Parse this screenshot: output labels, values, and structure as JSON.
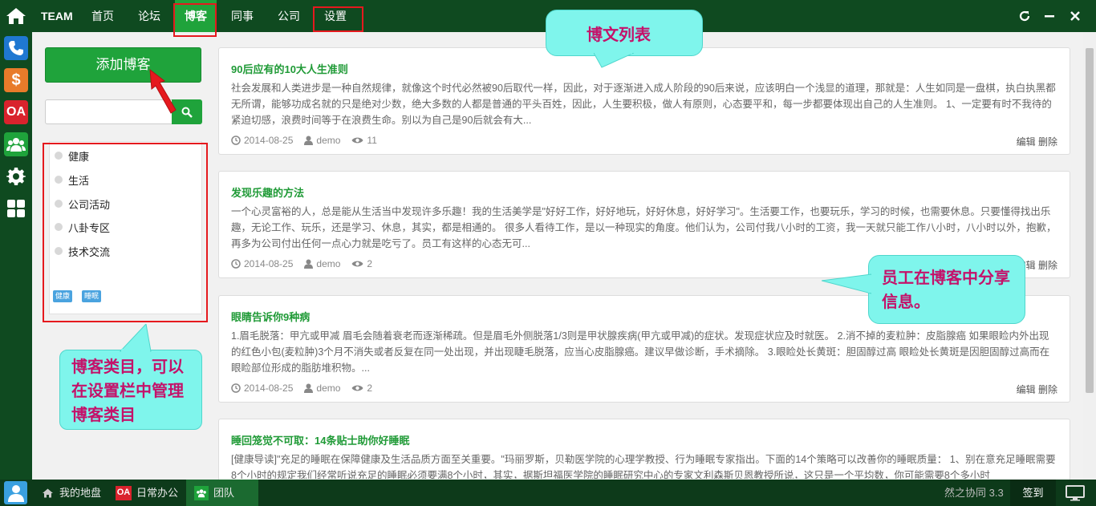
{
  "topnav": {
    "brand": "TEAM",
    "items": [
      "首页",
      "论坛",
      "博客",
      "同事",
      "公司",
      "设置"
    ],
    "active_index": 2
  },
  "window_controls": [
    "refresh-icon",
    "minimize-icon",
    "close-icon"
  ],
  "dock": {
    "items": [
      "home-icon",
      "phone-icon",
      "dollar-icon",
      "OA",
      "users-icon",
      "gear-icon",
      "grid-icon"
    ]
  },
  "sidebar": {
    "add_button": "添加博客",
    "search_placeholder": "",
    "categories": [
      "健康",
      "生活",
      "公司活动",
      "八卦专区",
      "技术交流"
    ],
    "tags": [
      "健康",
      "睡眠"
    ]
  },
  "posts": [
    {
      "title": "90后应有的10大人生准则",
      "excerpt": "社会发展和人类进步是一种自然规律，就像这个时代必然被90后取代一样，因此，对于逐渐进入成人阶段的90后来说，应该明白一个浅显的道理，那就是：人生如同是一盘棋，执白执黑都无所谓，能够功成名就的只是绝对少数，绝大多数的人都是普通的平头百姓，因此，人生要积极，做人有原则，心态要平和，每一步都要体现出自己的人生准则。 1、一定要有时不我待的紧迫切感，浪费时间等于在浪费生命。别以为自己是90后就会有大...",
      "date": "2014-08-25",
      "author": "demo",
      "views": "11",
      "edit": "编辑",
      "delete": "删除"
    },
    {
      "title": "发现乐趣的方法",
      "excerpt": "一个心灵富裕的人，总是能从生活当中发现许多乐趣！我的生活美学是\"好好工作，好好地玩，好好休息，好好学习\"。生活要工作，也要玩乐，学习的时候，也需要休息。只要懂得找出乐趣，无论工作、玩乐，还是学习、休息，其实，都是相通的。 很多人看待工作，是以一种现实的角度。他们认为，公司付我八小时的工资，我一天就只能工作八小时，八小时以外，抱歉，再多为公司付出任何一点心力就是吃亏了。员工有这样的心态无可...",
      "date": "2014-08-25",
      "author": "demo",
      "views": "2",
      "edit": "编辑",
      "delete": "删除"
    },
    {
      "title": "眼睛告诉你9种病",
      "excerpt": "1.眉毛脱落：甲亢或甲减 眉毛会随着衰老而逐渐稀疏。但是眉毛外侧脱落1/3则是甲状腺疾病(甲亢或甲减)的症状。发现症状应及时就医。 2.消不掉的麦粒肿：皮脂腺癌 如果眼睑内外出现的红色小包(麦粒肿)3个月不消失或者反复在同一处出现，并出现睫毛脱落，应当心皮脂腺癌。建议早做诊断，手术摘除。 3.眼睑处长黄斑：胆固醇过高 眼睑处长黄斑是因胆固醇过高而在眼睑部位形成的脂肪堆积物。...",
      "date": "2014-08-25",
      "author": "demo",
      "views": "2",
      "edit": "编辑",
      "delete": "删除"
    },
    {
      "title": "睡回笼觉不可取：14条贴士助你好睡眠",
      "excerpt": "[健康导读]\"充足的睡眠在保障健康及生活品质方面至关重要。\"玛丽罗斯，贝勒医学院的心理学教授、行为睡眠专家指出。下面的14个策略可以改善你的睡眠质量： 1、别在意充足睡眠需要8个小时的规定我们经常听说充足的睡眠必须要满8个小时，其实，据斯坦福医学院的睡眠研究中心的专家文利森斯贝恩教授所说，这只是一个平均数，你可能需要8个多小时",
      "date": "",
      "author": "",
      "views": ""
    }
  ],
  "callouts": {
    "post_list": "博文列表",
    "employee_share": "员工在博客中分享信息。",
    "category_note": "博客类目，可以在设置栏中管理博客类目"
  },
  "taskbar": {
    "items": [
      "我的地盘",
      "日常办公",
      "团队"
    ],
    "oa_badge": "OA",
    "active_index": 2,
    "version": "然之协同 3.3",
    "signin": "签到"
  },
  "colors": {
    "dark_green": "#0f4a20",
    "accent_green": "#1fa33b",
    "callout_bg": "#7ff5ec",
    "callout_text": "#c4126a",
    "highlight_red": "#e5191e"
  }
}
